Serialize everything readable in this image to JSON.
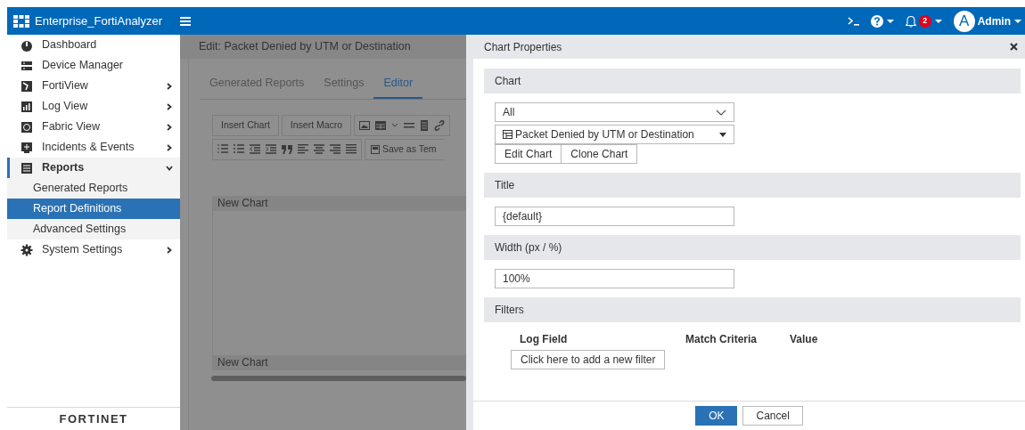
{
  "header": {
    "app_name": "Enterprise_FortiAnalyzer",
    "notification_count": "2",
    "avatar_letter": "A",
    "user": "Admin"
  },
  "sidebar": {
    "items": [
      {
        "label": "Dashboard",
        "selected": false
      },
      {
        "label": "Device Manager",
        "selected": false
      },
      {
        "label": "FortiView",
        "expanded": false,
        "selected": false
      },
      {
        "label": "Log View",
        "expanded": false,
        "selected": false
      },
      {
        "label": "Fabric View",
        "expanded": false,
        "selected": false
      },
      {
        "label": "Incidents & Events",
        "expanded": false,
        "selected": false
      },
      {
        "label": "Reports",
        "expanded": true,
        "selected": true,
        "children": [
          {
            "label": "Generated Reports",
            "selected": false
          },
          {
            "label": "Report Definitions",
            "selected": true
          },
          {
            "label": "Advanced Settings",
            "selected": false
          }
        ]
      },
      {
        "label": "System Settings",
        "expanded": false,
        "selected": false
      }
    ],
    "footer_logo": "FORTINET"
  },
  "editor": {
    "title": "Edit: Packet Denied by UTM or Destination",
    "tabs": [
      {
        "label": "Generated Reports",
        "selected": false
      },
      {
        "label": "Settings",
        "selected": false
      },
      {
        "label": "Editor",
        "selected": true
      }
    ],
    "toolbar_buttons": [
      "Insert Chart",
      "Insert Macro"
    ],
    "save_button": "Save as Tem",
    "chart_blocks": [
      "New Chart",
      "New Chart"
    ]
  },
  "chart_properties": {
    "title": "Chart Properties",
    "sections": [
      {
        "kind": "chart",
        "heading": "Chart",
        "category": "All",
        "chart": "Packet Denied by UTM or Destination",
        "buttons": [
          "Edit Chart",
          "Clone Chart"
        ]
      },
      {
        "kind": "text",
        "heading": "Title",
        "value": "{default}"
      },
      {
        "kind": "text",
        "heading": "Width (px / %)",
        "value": "100%"
      },
      {
        "kind": "filters",
        "heading": "Filters",
        "columns": [
          "Log Field",
          "Match Criteria",
          "Value"
        ],
        "add_button": "Click here to add a new filter"
      }
    ],
    "buttons": [
      {
        "label": "OK",
        "primary": true
      },
      {
        "label": "Cancel",
        "primary": false
      }
    ]
  }
}
